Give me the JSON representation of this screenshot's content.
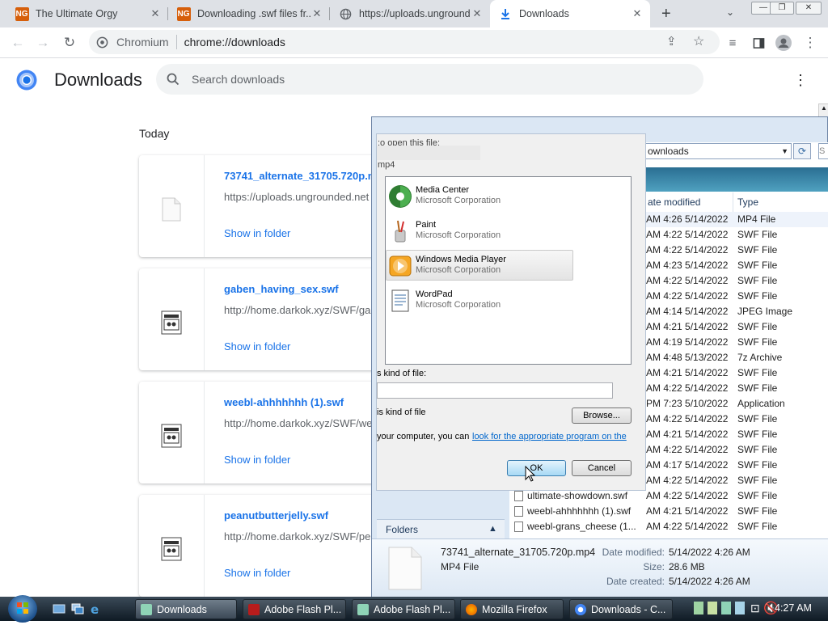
{
  "browser": {
    "tabs": [
      {
        "title": "The Ultimate Orgy",
        "favicon": "ng-icon",
        "active": false
      },
      {
        "title": "Downloading .swf files fr...",
        "favicon": "ng-icon",
        "active": false
      },
      {
        "title": "https://uploads.ungrounde...",
        "favicon": "globe-icon",
        "active": false
      },
      {
        "title": "Downloads",
        "favicon": "download-icon",
        "active": true
      }
    ],
    "omnibox": {
      "site": "Chromium",
      "url": "chrome://downloads"
    }
  },
  "downloads": {
    "title": "Downloads",
    "search_placeholder": "Search downloads",
    "section": "Today",
    "items": [
      {
        "name": "73741_alternate_31705.720p.mp4",
        "source": "https://uploads.ungrounded.net",
        "action": "Show in folder"
      },
      {
        "name": "gaben_having_sex.swf",
        "source": "http://home.darkok.xyz/SWF/ga",
        "action": "Show in folder"
      },
      {
        "name": "weebl-ahhhhhhh (1).swf",
        "source": "http://home.darkok.xyz/SWF/we",
        "action": "Show in folder"
      },
      {
        "name": "peanutbutterjelly.swf",
        "source": "http://home.darkok.xyz/SWF/pe",
        "action": "Show in folder"
      }
    ]
  },
  "open_with": {
    "prompt": ":o open this file:",
    "ext": "mp4",
    "programs": [
      {
        "name": "Media Center",
        "company": "Microsoft Corporation",
        "icon": "media-center-icon",
        "selected": false
      },
      {
        "name": "Paint",
        "company": "Microsoft Corporation",
        "icon": "paint-icon",
        "selected": false
      },
      {
        "name": "Windows Media Player",
        "company": "Microsoft Corporation",
        "icon": "media-player-icon",
        "selected": true
      },
      {
        "name": "WordPad",
        "company": "Microsoft Corporation",
        "icon": "wordpad-icon",
        "selected": false
      }
    ],
    "kind_label": "s kind of file:",
    "always_label": "is kind of file",
    "browse": "Browse...",
    "lookup_prefix": "your computer, you can",
    "lookup_link": "look for the appropriate program on the",
    "ok": "OK",
    "cancel": "Cancel"
  },
  "explorer": {
    "path": "ownloads",
    "columns": {
      "date": "ate modified",
      "type": "Type"
    },
    "rows": [
      {
        "name": "",
        "date": "5/14/2022 4:26 AM",
        "type": "MP4 File"
      },
      {
        "name": "",
        "date": "5/14/2022 4:22 AM",
        "type": "SWF File"
      },
      {
        "name": "",
        "date": "5/14/2022 4:22 AM",
        "type": "SWF File"
      },
      {
        "name": "",
        "date": "5/14/2022 4:23 AM",
        "type": "SWF File"
      },
      {
        "name": "",
        "date": "5/14/2022 4:22 AM",
        "type": "SWF File"
      },
      {
        "name": "",
        "date": "5/14/2022 4:22 AM",
        "type": "SWF File"
      },
      {
        "name": "",
        "date": "5/14/2022 4:14 AM",
        "type": "JPEG Image"
      },
      {
        "name": "",
        "date": "5/14/2022 4:21 AM",
        "type": "SWF File"
      },
      {
        "name": "",
        "date": "5/14/2022 4:19 AM",
        "type": "SWF File"
      },
      {
        "name": "",
        "date": "5/13/2022 4:48 AM",
        "type": "7z Archive"
      },
      {
        "name": "",
        "date": "5/14/2022 4:21 AM",
        "type": "SWF File"
      },
      {
        "name": "",
        "date": "5/14/2022 4:22 AM",
        "type": "SWF File"
      },
      {
        "name": "",
        "date": "5/10/2022 7:23 PM",
        "type": "Application"
      },
      {
        "name": "",
        "date": "5/14/2022 4:22 AM",
        "type": "SWF File"
      },
      {
        "name": "",
        "date": "5/14/2022 4:21 AM",
        "type": "SWF File"
      },
      {
        "name": "",
        "date": "5/14/2022 4:22 AM",
        "type": "SWF File"
      },
      {
        "name": "",
        "date": "5/14/2022 4:17 AM",
        "type": "SWF File"
      },
      {
        "name": "",
        "date": "5/14/2022 4:22 AM",
        "type": "SWF File"
      },
      {
        "name": "ultimate-showdown.swf",
        "date": "5/14/2022 4:22 AM",
        "type": "SWF File"
      },
      {
        "name": "weebl-ahhhhhhh (1).swf",
        "date": "5/14/2022 4:21 AM",
        "type": "SWF File"
      },
      {
        "name": "weebl-grans_cheese (1...",
        "date": "5/14/2022 4:22 AM",
        "type": "SWF File"
      }
    ],
    "folders": "Folders",
    "details": {
      "filename": "73741_alternate_31705.720p.mp4",
      "filetype": "MP4 File",
      "labels": {
        "modified": "Date modified:",
        "size": "Size:",
        "created": "Date created:"
      },
      "modified": "5/14/2022 4:26 AM",
      "size": "28.6 MB",
      "created": "5/14/2022 4:26 AM"
    }
  },
  "taskbar": {
    "tasks": [
      {
        "label": "Downloads",
        "active": true
      },
      {
        "label": "Adobe Flash Pl...",
        "active": false
      },
      {
        "label": "Adobe Flash Pl...",
        "active": false
      },
      {
        "label": "Mozilla Firefox",
        "active": false
      },
      {
        "label": "Downloads - C...",
        "active": false
      }
    ],
    "clock": "4:27 AM"
  }
}
